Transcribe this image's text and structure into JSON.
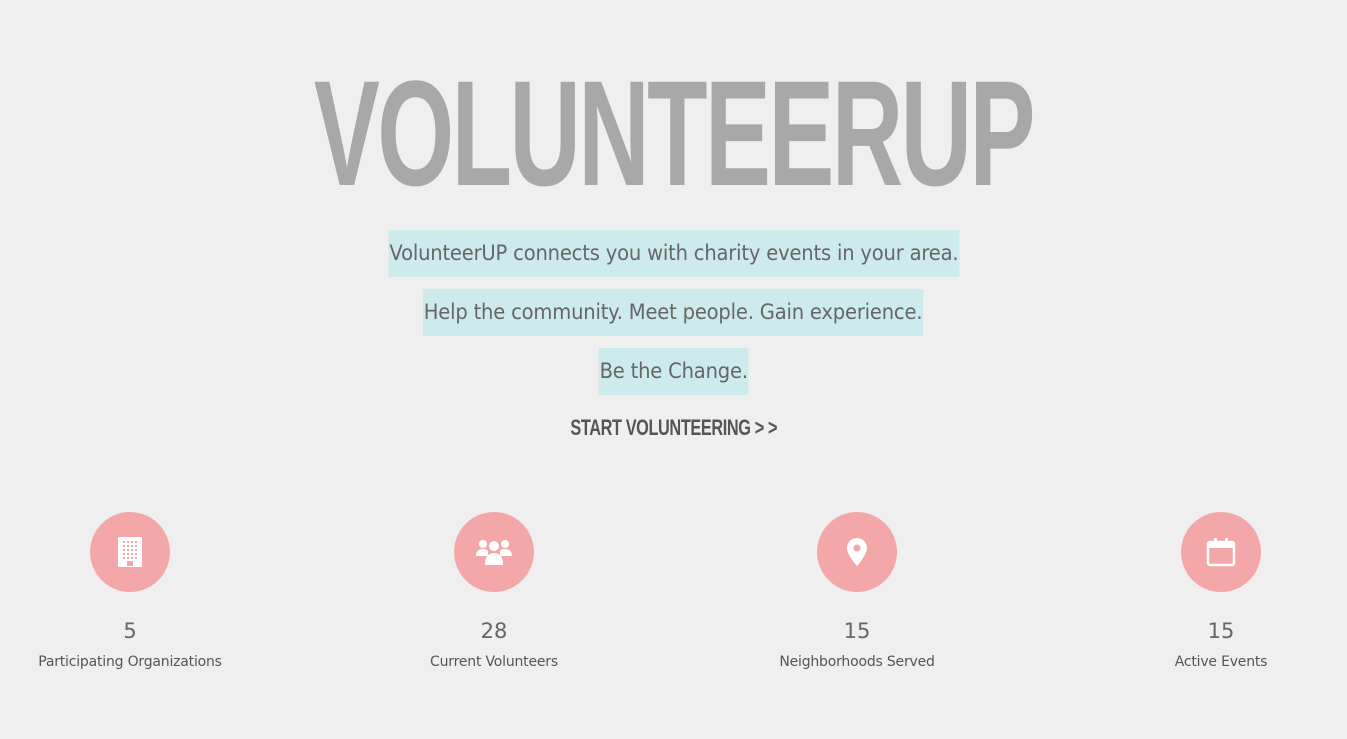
{
  "hero": {
    "logo": "VOLUNTEERUP",
    "taglines": [
      "VolunteerUP connects you with charity events in your area.",
      "Help the community. Meet people. Gain experience.",
      "Be the Change."
    ],
    "cta_label": "START VOLUNTEERING > >"
  },
  "colors": {
    "background": "#efefef",
    "logo": "#a8a8a8",
    "highlight": "#cdeaec",
    "stat_circle": "#f4a7a8"
  },
  "stats": [
    {
      "icon": "building-icon",
      "value": "5",
      "label": "Participating Organizations"
    },
    {
      "icon": "people-icon",
      "value": "28",
      "label": "Current Volunteers"
    },
    {
      "icon": "map-pin-icon",
      "value": "15",
      "label": "Neighborhoods Served"
    },
    {
      "icon": "calendar-icon",
      "value": "15",
      "label": "Active Events"
    }
  ]
}
